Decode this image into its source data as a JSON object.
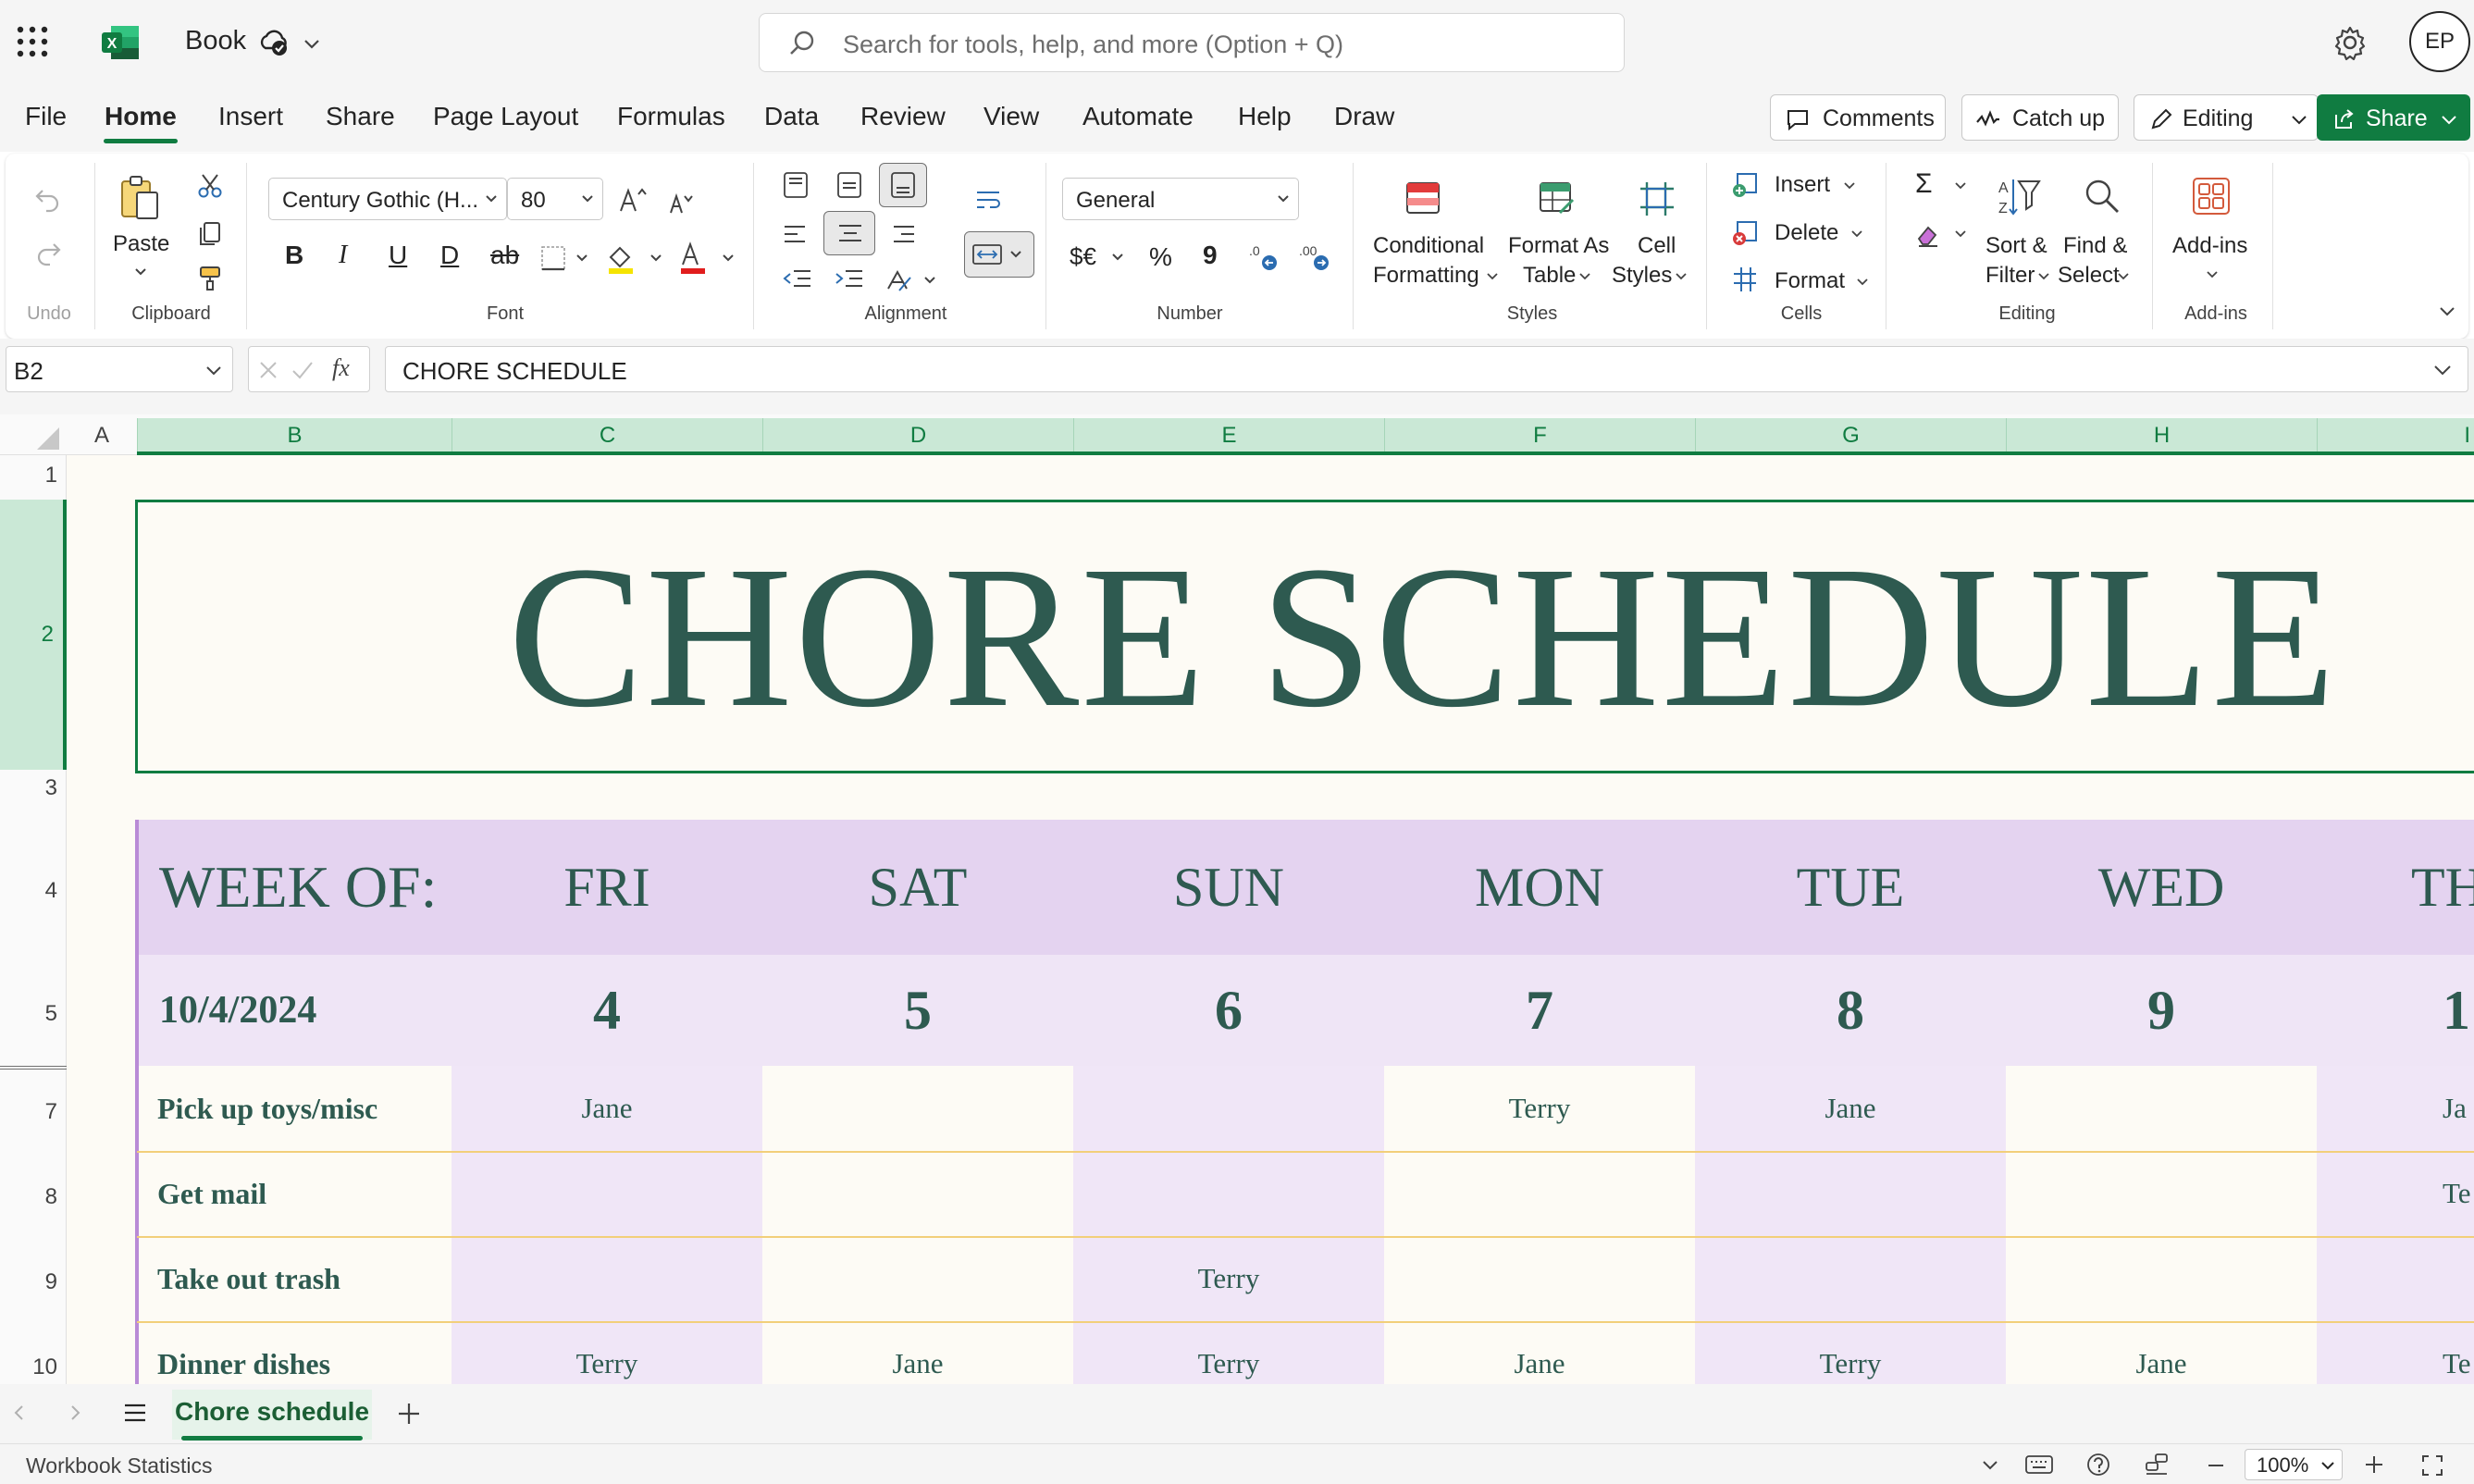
{
  "app": {
    "book_name": "Book",
    "search_placeholder": "Search for tools, help, and more (Option + Q)",
    "avatar_initials": "EP"
  },
  "menu": {
    "tabs": [
      "File",
      "Home",
      "Insert",
      "Share",
      "Page Layout",
      "Formulas",
      "Data",
      "Review",
      "View",
      "Automate",
      "Help",
      "Draw"
    ],
    "active_tab": "Home",
    "comments_label": "Comments",
    "catchup_label": "Catch up",
    "editing_label": "Editing",
    "share_label": "Share"
  },
  "ribbon": {
    "undo_group": "Undo",
    "paste_label": "Paste",
    "clipboard_group": "Clipboard",
    "font_name": "Century Gothic (H...",
    "font_size": "80",
    "font_group": "Font",
    "alignment_group": "Alignment",
    "number_format": "General",
    "number_group": "Number",
    "currency_symbol": "$€",
    "percent_symbol": "%",
    "comma_symbol": "9",
    "cond_format_1": "Conditional",
    "cond_format_2": "Formatting",
    "format_table_1": "Format As",
    "format_table_2": "Table",
    "cell_styles_1": "Cell",
    "cell_styles_2": "Styles",
    "styles_group": "Styles",
    "insert_label": "Insert",
    "delete_label": "Delete",
    "format_label": "Format",
    "cells_group": "Cells",
    "sort_1": "Sort &",
    "sort_2": "Filter",
    "find_1": "Find &",
    "find_2": "Select",
    "editing_group": "Editing",
    "addins_label": "Add-ins",
    "addins_group": "Add-ins"
  },
  "formula_bar": {
    "cell_ref": "B2",
    "formula": "CHORE SCHEDULE",
    "fx": "fx"
  },
  "columns": [
    "A",
    "B",
    "C",
    "D",
    "E",
    "F",
    "G",
    "H",
    "I"
  ],
  "rows": [
    "1",
    "2",
    "3",
    "4",
    "5",
    "7",
    "8",
    "9",
    "10"
  ],
  "sheet": {
    "title": "CHORE SCHEDULE",
    "week_of_label": "WEEK OF:",
    "days": [
      "FRI",
      "SAT",
      "SUN",
      "MON",
      "TUE",
      "WED",
      "TH"
    ],
    "date": "10/4/2024",
    "day_numbers": [
      "4",
      "5",
      "6",
      "7",
      "8",
      "9",
      "1"
    ],
    "chores": [
      {
        "name": "Pick up toys/misc",
        "cells": [
          "Jane",
          "",
          "",
          "Terry",
          "Jane",
          "",
          "Ja"
        ]
      },
      {
        "name": "Get mail",
        "cells": [
          "",
          "",
          "",
          "",
          "",
          "",
          "Te"
        ]
      },
      {
        "name": "Take out trash",
        "cells": [
          "",
          "",
          "Terry",
          "",
          "",
          "",
          ""
        ]
      },
      {
        "name": "Dinner dishes",
        "cells": [
          "Terry",
          "Jane",
          "Terry",
          "Jane",
          "Terry",
          "Jane",
          "Te"
        ]
      }
    ]
  },
  "sheet_tabs": {
    "active": "Chore schedule"
  },
  "status": {
    "left_text": "Workbook Statistics",
    "zoom": "100%"
  },
  "colors": {
    "accent_green": "#107c41",
    "title_text": "#2e5a50",
    "header_purple": "#e4d3f0",
    "date_purple": "#efe5f6",
    "cell_cream": "#fdfbf5",
    "row_divider": "#f2cf7a"
  }
}
